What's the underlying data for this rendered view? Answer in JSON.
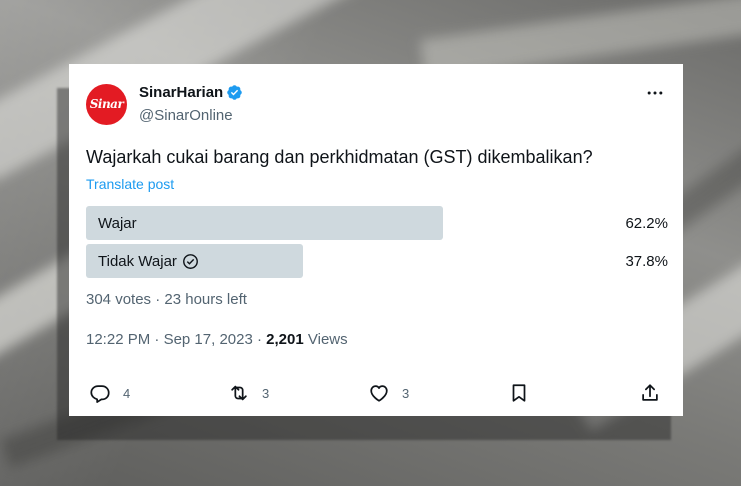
{
  "post": {
    "display_name": "SinarHarian",
    "handle": "@SinarOnline",
    "avatar_text": "Sinar",
    "text": "Wajarkah cukai barang dan perkhidmatan (GST) dikembalikan?",
    "translate_label": "Translate post",
    "poll": {
      "options": [
        {
          "label": "Wajar",
          "percent_label": "62.2%",
          "percent": 62.2,
          "selected": false
        },
        {
          "label": "Tidak Wajar",
          "percent_label": "37.8%",
          "percent": 37.8,
          "selected": true
        }
      ],
      "votes": "304 votes",
      "separator": "·",
      "time_left": "23 hours left"
    },
    "time": "12:22 PM",
    "date": "Sep 17, 2023",
    "views_count": "2,201",
    "views_label": "Views",
    "actions": {
      "reply_count": "4",
      "repost_count": "3",
      "like_count": "3"
    },
    "icons": [
      "verified-badge-icon",
      "more-icon",
      "check-circle-icon",
      "reply-icon",
      "repost-icon",
      "like-icon",
      "bookmark-icon",
      "share-icon"
    ],
    "colors": {
      "accent": "#1d9bf0",
      "poll_bar": "#cfd9de",
      "brand_red": "#e31b23"
    }
  }
}
